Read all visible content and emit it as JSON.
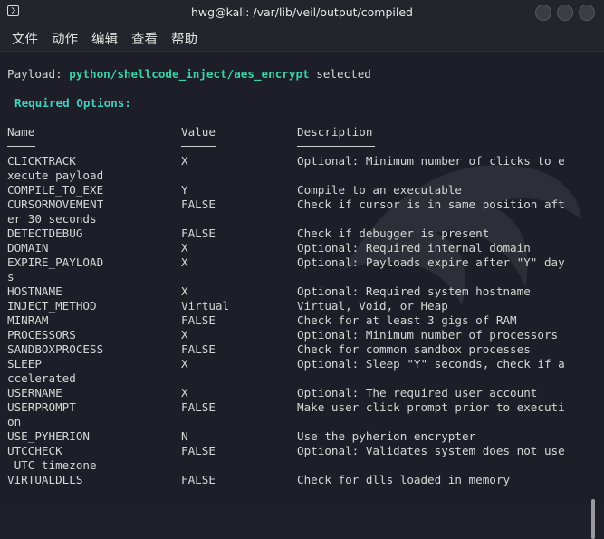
{
  "window": {
    "title": "hwg@kali: /var/lib/veil/output/compiled"
  },
  "menu": [
    "文件",
    "动作",
    "编辑",
    "查看",
    "帮助"
  ],
  "terminal": {
    "payload_prefix": "Payload: ",
    "payload_name": "python/shellcode_inject/aes_encrypt",
    "payload_suffix": " selected",
    "required_heading": "Required Options:",
    "headers": {
      "name": "Name",
      "value": "Value",
      "description": "Description"
    },
    "rows": [
      {
        "name": "CLICKTRACK",
        "value": "X",
        "desc": "Optional: Minimum number of clicks to e",
        "wrap": "xecute payload"
      },
      {
        "name": "COMPILE_TO_EXE",
        "value": "Y",
        "desc": "Compile to an executable",
        "wrap": ""
      },
      {
        "name": "CURSORMOVEMENT",
        "value": "FALSE",
        "desc": "Check if cursor is in same position aft",
        "wrap": "er 30 seconds"
      },
      {
        "name": "DETECTDEBUG",
        "value": "FALSE",
        "desc": "Check if debugger is present",
        "wrap": ""
      },
      {
        "name": "DOMAIN",
        "value": "X",
        "desc": "Optional: Required internal domain",
        "wrap": ""
      },
      {
        "name": "EXPIRE_PAYLOAD",
        "value": "X",
        "desc": "Optional: Payloads expire after \"Y\" day",
        "wrap": "s"
      },
      {
        "name": "HOSTNAME",
        "value": "X",
        "desc": "Optional: Required system hostname",
        "wrap": ""
      },
      {
        "name": "INJECT_METHOD",
        "value": "Virtual",
        "desc": "Virtual, Void, or Heap",
        "wrap": ""
      },
      {
        "name": "MINRAM",
        "value": "FALSE",
        "desc": "Check for at least 3 gigs of RAM",
        "wrap": ""
      },
      {
        "name": "PROCESSORS",
        "value": "X",
        "desc": "Optional: Minimum number of processors",
        "wrap": ""
      },
      {
        "name": "SANDBOXPROCESS",
        "value": "FALSE",
        "desc": "Check for common sandbox processes",
        "wrap": ""
      },
      {
        "name": "SLEEP",
        "value": "X",
        "desc": "Optional: Sleep \"Y\" seconds, check if a",
        "wrap": "ccelerated"
      },
      {
        "name": "USERNAME",
        "value": "X",
        "desc": "Optional: The required user account",
        "wrap": ""
      },
      {
        "name": "USERPROMPT",
        "value": "FALSE",
        "desc": "Make user click prompt prior to executi",
        "wrap": "on"
      },
      {
        "name": "USE_PYHERION",
        "value": "N",
        "desc": "Use the pyherion encrypter",
        "wrap": ""
      },
      {
        "name": "UTCCHECK",
        "value": "FALSE",
        "desc": "Optional: Validates system does not use",
        "wrap": " UTC timezone"
      },
      {
        "name": "VIRTUALDLLS",
        "value": "FALSE",
        "desc": "Check for dlls loaded in memory",
        "wrap": ""
      }
    ]
  },
  "colors": {
    "background": "#1d1e28",
    "payload_name": "#39d3a6",
    "heading": "#3fd0c0",
    "text": "#d6d6d6"
  },
  "icons": {
    "app": "terminal-icon",
    "window_buttons": [
      "minimize-icon",
      "maximize-icon",
      "close-icon"
    ]
  }
}
